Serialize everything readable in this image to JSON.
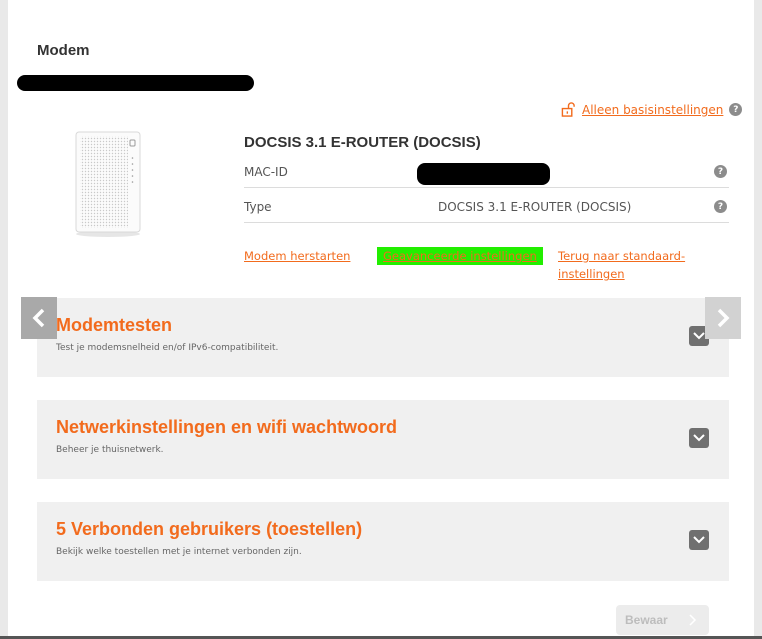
{
  "section_title": "Modem",
  "basis_link": "Alleen basisinstellingen",
  "help_glyph": "?",
  "product_name": "DOCSIS 3.1 E-ROUTER (DOCSIS)",
  "rows": [
    {
      "label": "MAC-ID",
      "value": ""
    },
    {
      "label": "Type",
      "value": "DOCSIS 3.1 E-ROUTER (DOCSIS)"
    }
  ],
  "actions": {
    "restart": "Modem herstarten",
    "advanced": "Geavanceerde instellingen",
    "reset_line1": "Terug naar standaard-",
    "reset_line2": "instellingen"
  },
  "cards": [
    {
      "title": "Modemtesten",
      "subtitle": "Test je modemsnelheid en/of IPv6-compatibiliteit."
    },
    {
      "title": "Netwerkinstellingen en wifi wachtwoord",
      "subtitle": "Beheer je thuisnetwerk."
    },
    {
      "title": "5 Verbonden gebruikers (toestellen)",
      "subtitle": "Bekijk welke toestellen met je internet verbonden zijn."
    }
  ],
  "save_button": "Bewaar",
  "colors": {
    "accent": "#f26b1d",
    "highlight": "#22ee00",
    "card_bg": "#f0f0f0"
  },
  "icons": [
    "lock-open-icon",
    "help-icon",
    "chevron-down-icon",
    "chevron-left-icon",
    "chevron-right-icon",
    "arrow-right-icon"
  ]
}
